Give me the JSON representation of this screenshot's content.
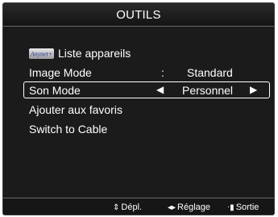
{
  "title": "OUTILS",
  "menu": {
    "anynet": {
      "logo_text": "Anynet+",
      "label": "Liste appareils"
    },
    "image_mode": {
      "label": "Image Mode",
      "separator": ":",
      "value": "Standard"
    },
    "son_mode": {
      "label": "Son Mode",
      "value": "Personnel"
    },
    "favoris": {
      "label": "Ajouter aux favoris"
    },
    "cable": {
      "label": "Switch to Cable"
    }
  },
  "footer": {
    "move": {
      "icon": "updown-arrows-icon",
      "label": "Dépl."
    },
    "adjust": {
      "icon": "leftright-arrows-icon",
      "label": "Réglage"
    },
    "exit": {
      "icon": "exit-icon",
      "label": "Sortie"
    }
  },
  "colors": {
    "background": "#1b1b1c",
    "text": "#ffffff",
    "selection_border": "#ffffff"
  }
}
